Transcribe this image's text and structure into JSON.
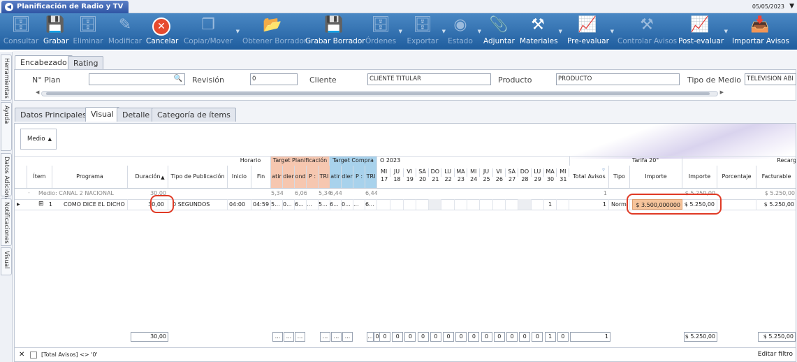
{
  "window": {
    "title": "Planificación de Radio y TV",
    "date": "05/05/2023"
  },
  "toolbar": [
    {
      "name": "consultar",
      "label": "Consultar",
      "icon": "db-search-icon",
      "enabled": false
    },
    {
      "name": "grabar",
      "label": "Grabar",
      "icon": "save-icon",
      "enabled": true
    },
    {
      "name": "eliminar",
      "label": "Eliminar",
      "icon": "db-delete-icon",
      "enabled": false
    },
    {
      "name": "modificar",
      "label": "Modificar",
      "icon": "edit-icon",
      "enabled": false
    },
    {
      "name": "cancelar",
      "label": "Cancelar",
      "icon": "cancel-icon",
      "enabled": true
    },
    {
      "name": "copiar",
      "label": "Copiar/Mover",
      "icon": "copy-icon",
      "enabled": false
    },
    {
      "name": "obtener-borrador",
      "label": "Obtener Borrador",
      "icon": "folder-icon",
      "enabled": false
    },
    {
      "name": "grabar-borrador",
      "label": "Grabar Borrador",
      "icon": "save-draft-icon",
      "enabled": true
    },
    {
      "name": "ordenes",
      "label": "Órdenes",
      "icon": "orders-icon",
      "enabled": false
    },
    {
      "name": "exportar",
      "label": "Exportar",
      "icon": "export-icon",
      "enabled": false
    },
    {
      "name": "estado",
      "label": "Estado",
      "icon": "status-icon",
      "enabled": false
    },
    {
      "name": "adjuntar",
      "label": "Adjuntar",
      "icon": "attach-icon",
      "enabled": true
    },
    {
      "name": "materiales",
      "label": "Materiales",
      "icon": "tools-icon",
      "enabled": true
    },
    {
      "name": "pre-evaluar",
      "label": "Pre-evaluar",
      "icon": "chart-icon",
      "enabled": true
    },
    {
      "name": "controlar-avisos",
      "label": "Controlar Avisos",
      "icon": "tools-icon",
      "enabled": false
    },
    {
      "name": "post-evaluar",
      "label": "Post-evaluar",
      "icon": "chart-icon",
      "enabled": true
    },
    {
      "name": "importar-avisos",
      "label": "Importar Avisos",
      "icon": "import-icon",
      "enabled": true
    }
  ],
  "sidetabs": [
    "Herramientas",
    "Ayuda",
    "Datos Adicionales",
    "Notificaciones",
    "Visual"
  ],
  "top_tabs": [
    "Encabezado",
    "Rating"
  ],
  "header": {
    "nplan_label": "N° Plan",
    "nplan_value": "",
    "revision_label": "Revisión",
    "revision_value": "0",
    "cliente_label": "Cliente",
    "cliente_value": "CLIENTE TITULAR",
    "producto_label": "Producto",
    "producto_value": "PRODUCTO",
    "tipo_medio_label": "Tipo de Medio",
    "tipo_medio_value": "TELEVISION ABI"
  },
  "sub_tabs": [
    "Datos Principales",
    "Visual",
    "Detalle",
    "Categoría de ítems"
  ],
  "grid": {
    "group_button": "Medio",
    "band_headers": {
      "horario": "Horario",
      "target_plan": "Target Planificación",
      "target_compra": "Target Compra",
      "month": "O 2023",
      "tarifa": "Tarifa 20\"",
      "recargo": "Recarg"
    },
    "columns": {
      "item": "Ítem",
      "programa": "Programa",
      "duracion": "Duración",
      "tipo_pub": "Tipo de Publicación",
      "inicio": "Inicio",
      "fin": "Fin",
      "total_avisos": "Total Avisos",
      "tipo": "Tipo",
      "importe_tarifa": "Importe",
      "importe": "Importe",
      "porcentaje": "Porcentaje",
      "facturable": "Facturable"
    },
    "target_plan_cols": [
      "atir",
      "dier",
      "ond",
      "P :",
      "TRI"
    ],
    "target_compra_cols": [
      "atir",
      "dier",
      "P :",
      "TRI"
    ],
    "days": [
      [
        "MI",
        "17"
      ],
      [
        "JU",
        "18"
      ],
      [
        "VI",
        "19"
      ],
      [
        "SÁ",
        "20"
      ],
      [
        "DO",
        "21"
      ],
      [
        "LU",
        "22"
      ],
      [
        "MA",
        "23"
      ],
      [
        "MI",
        "24"
      ],
      [
        "JU",
        "25"
      ],
      [
        "VI",
        "26"
      ],
      [
        "SÁ",
        "27"
      ],
      [
        "DO",
        "28"
      ],
      [
        "LU",
        "29"
      ],
      [
        "MA",
        "30"
      ],
      [
        "MI",
        "31"
      ]
    ],
    "group_row": {
      "label": "Medio: CANAL 2 NACIONAL",
      "duracion": "30,00",
      "tp": [
        "5,34",
        "",
        "6,06",
        "",
        "5,34"
      ],
      "tc": [
        "6,44",
        "",
        "",
        "6,44"
      ],
      "total_avisos": "1",
      "importe": "$ 5.250,00",
      "facturable": "$ 5.250,00"
    },
    "row": {
      "expand": "⊞",
      "num": "1",
      "programa": "COMO DICE EL DICHO",
      "duracion": "30,00",
      "tipo_pub": "0 SEGUNDOS",
      "inicio": "04:00",
      "fin": "04:59",
      "tp": [
        "5...",
        "0...",
        "6...",
        "...",
        "5..."
      ],
      "tc": [
        "6...",
        "0...",
        "...",
        "6..."
      ],
      "days": [
        "",
        "",
        "",
        "",
        "",
        "",
        "",
        "",
        "",
        "",
        "",
        "",
        "",
        "1",
        ""
      ],
      "total_avisos": "1",
      "tipo": "Norm",
      "importe_tarifa": "$ 3.500,000000",
      "importe": "$ 5.250,00",
      "facturable": "$ 5.250,00"
    },
    "footer": {
      "duracion": "30,00",
      "tp": [
        "...",
        "...",
        "..."
      ],
      "tp2": [
        "...",
        "...",
        "..."
      ],
      "tc": [
        "...",
        "0"
      ],
      "days": [
        "0",
        "0",
        "0",
        "0",
        "0",
        "0",
        "0",
        "0",
        "0",
        "0",
        "0",
        "0",
        "0",
        "1",
        "0"
      ],
      "total_avisos": "1",
      "importe": "$ 5.250,00",
      "facturable": "$ 5.250,00"
    },
    "filter": {
      "text": "[Total Avisos] <> '0'",
      "edit": "Editar filtro"
    }
  }
}
